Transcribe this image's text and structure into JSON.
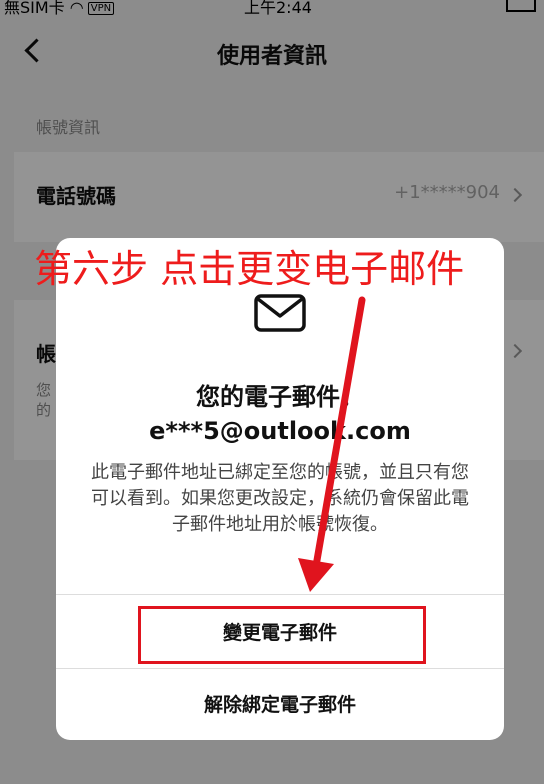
{
  "status_bar": {
    "carrier": "無SIM卡",
    "vpn_label": "VPN",
    "time": "上午2:44"
  },
  "nav": {
    "title": "使用者資訊"
  },
  "section_label": "帳號資訊",
  "phone_row": {
    "label": "電話號碼",
    "value": "+1*****904"
  },
  "account_row": {
    "label_partial": "帳",
    "desc_partial": "您的"
  },
  "dialog": {
    "icon": "mail-icon",
    "title_line1": "您的電子郵件：",
    "title_line2": "e***5@outlook.com",
    "body": "此電子郵件地址已綁定至您的帳號，並且只有您可以看到。如果您更改設定，系統仍會保留此電子郵件地址用於帳號恢復。",
    "change_button": "變更電子郵件",
    "unbind_button": "解除綁定電子郵件"
  },
  "annotation": {
    "text": "第六步 点击更变电子邮件",
    "color": "#ee1c1c"
  }
}
